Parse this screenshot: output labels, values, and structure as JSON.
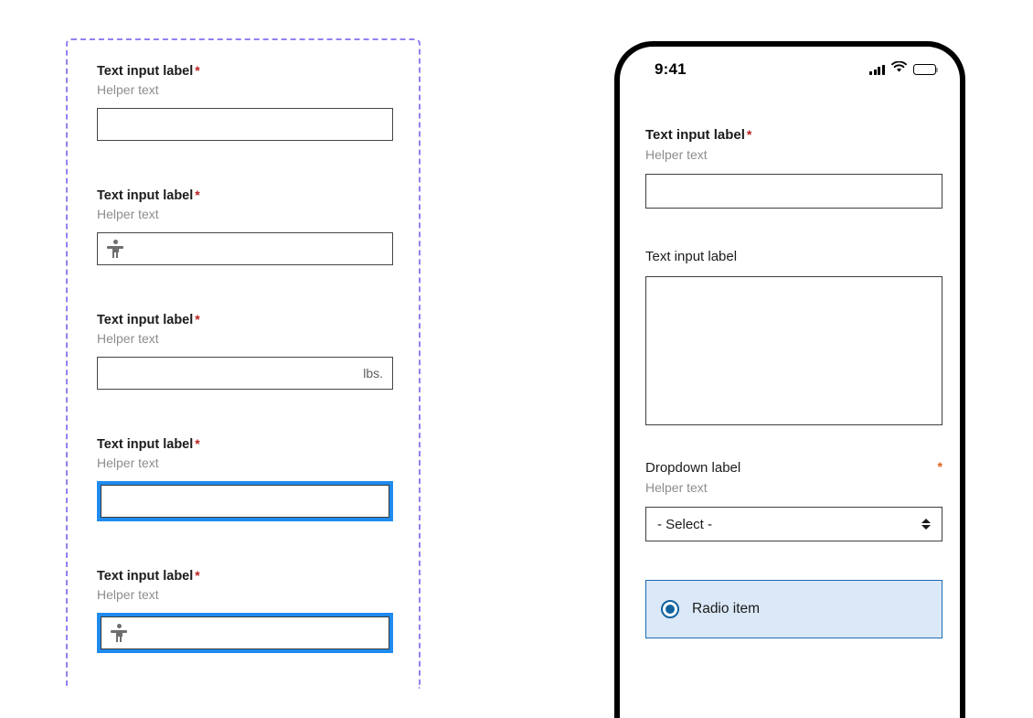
{
  "desktop_panel": {
    "fields": [
      {
        "label": "Text input label",
        "required_marker": "*",
        "helper": "Helper text",
        "value": "",
        "suffix": "",
        "icon": "",
        "state": "default"
      },
      {
        "label": "Text input label",
        "required_marker": "*",
        "helper": "Helper text",
        "value": "",
        "suffix": "",
        "icon": "accessibility-icon",
        "state": "default"
      },
      {
        "label": "Text input label",
        "required_marker": "*",
        "helper": "Helper text",
        "value": "",
        "suffix": "lbs.",
        "icon": "",
        "state": "default"
      },
      {
        "label": "Text input label",
        "required_marker": "*",
        "helper": "Helper text",
        "value": "",
        "suffix": "",
        "icon": "",
        "state": "focused"
      },
      {
        "label": "Text input label",
        "required_marker": "*",
        "helper": "Helper text",
        "value": "",
        "suffix": "",
        "icon": "accessibility-icon",
        "state": "focused"
      }
    ]
  },
  "phone": {
    "status_bar": {
      "time": "9:41",
      "cellular_icon": "cellular-bars-icon",
      "wifi_icon": "wifi-icon",
      "battery_icon": "battery-full-icon"
    },
    "text_field": {
      "label": "Text input label",
      "required_marker": "*",
      "helper": "Helper text",
      "value": ""
    },
    "textarea_field": {
      "label": "Text input label",
      "value": ""
    },
    "dropdown_field": {
      "label": "Dropdown label",
      "required_marker": "*",
      "helper": "Helper text",
      "selected": "- Select -",
      "options": [
        "- Select -"
      ]
    },
    "radio": {
      "label": "Radio item",
      "selected": true
    }
  },
  "colors": {
    "required_red": "#bb2222",
    "required_orange": "#e2601c",
    "focus_blue": "#1f8bef",
    "radio_blue": "#11639f",
    "radio_bg": "#dbe8f7",
    "dashed_purple": "#8f82ef",
    "helper_gray": "#8d8d8d",
    "border_gray": "#3f3f3f"
  }
}
